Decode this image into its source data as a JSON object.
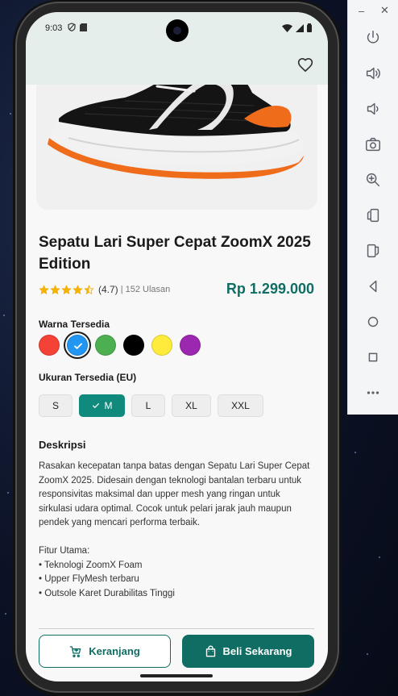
{
  "status_bar": {
    "time": "9:03"
  },
  "product": {
    "title": "Sepatu Lari Super Cepat ZoomX 2025 Edition",
    "rating": "(4.7)",
    "reviews": "| 152 Ulasan",
    "rating_value": 4.5,
    "rating_max": 5,
    "price": "Rp 1.299.000"
  },
  "colors": {
    "label": "Warna Tersedia",
    "swatches": [
      "#f44336",
      "#2196f3",
      "#4caf50",
      "#000000",
      "#ffeb3b",
      "#9c27b0"
    ],
    "selected_index": 1
  },
  "sizes": {
    "label": "Ukuran Tersedia (EU)",
    "options": [
      "S",
      "M",
      "L",
      "XL",
      "XXL"
    ],
    "selected_index": 1
  },
  "description": {
    "title": "Deskripsi",
    "text": "Rasakan kecepatan tanpa batas dengan Sepatu Lari Super Cepat ZoomX 2025. Didesain dengan teknologi bantalan terbaru untuk responsivitas maksimal dan upper mesh yang ringan untuk sirkulasi udara optimal. Cocok untuk pelari jarak jauh maupun pendek yang mencari performa terbaik.\n\nFitur Utama:\n• Teknologi ZoomX Foam\n• Upper FlyMesh terbaru\n• Outsole Karet Durabilitas Tinggi"
  },
  "actions": {
    "cart_label": "Keranjang",
    "buy_label": "Beli Sekarang"
  },
  "theme": {
    "accent": "#0f6d63",
    "accent_light": "#0f8a7c",
    "appbar_bg": "#e6eeec"
  },
  "icons": {
    "favorite": "heart-outline-icon",
    "cart": "shopping-cart-icon",
    "buy": "shopping-bag-icon"
  },
  "emulator_toolbar": [
    "power-icon",
    "volume-up-icon",
    "volume-down-icon",
    "camera-icon",
    "zoom-icon",
    "rotate-left-icon",
    "rotate-right-icon",
    "back-icon",
    "home-icon",
    "overview-icon",
    "more-icon"
  ]
}
